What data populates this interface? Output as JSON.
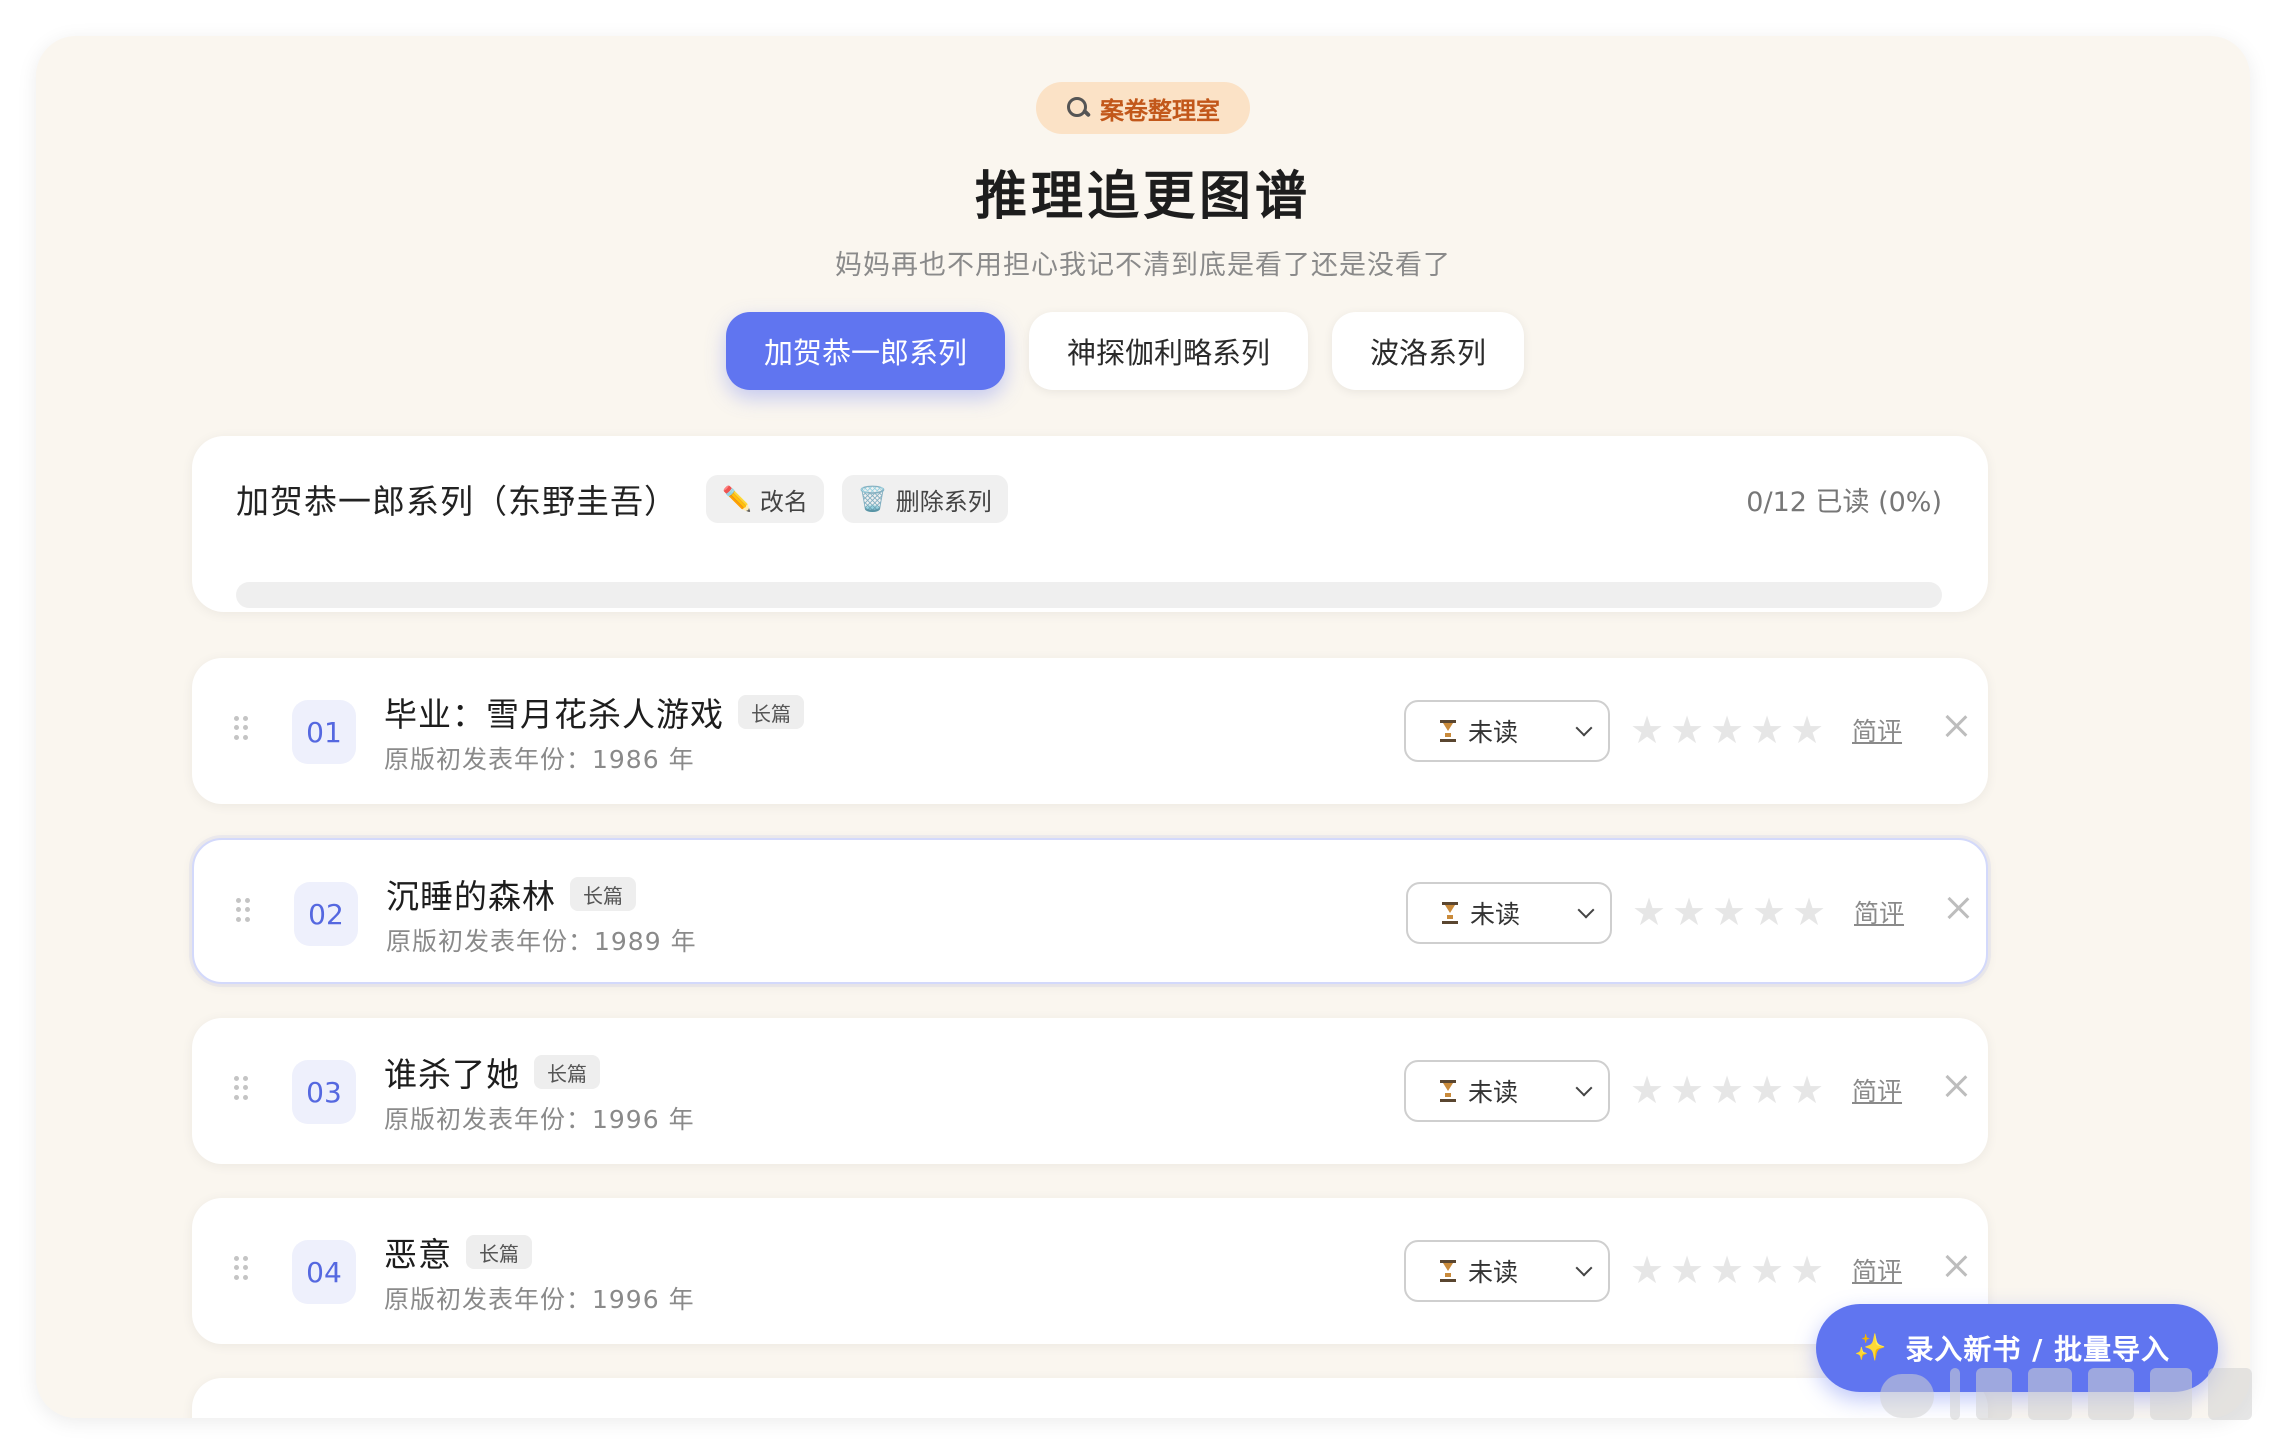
{
  "header": {
    "badge": "案卷整理室",
    "title": "推理追更图谱",
    "subtitle": "妈妈再也不用担心我记不清到底是看了还是没看了"
  },
  "tabs": [
    {
      "label": "加贺恭一郎系列",
      "active": true
    },
    {
      "label": "神探伽利略系列",
      "active": false
    },
    {
      "label": "波洛系列",
      "active": false
    }
  ],
  "series": {
    "name": "加贺恭一郎系列（东野圭吾）",
    "rename_label": "改名",
    "delete_label": "删除系列",
    "progress_text": "0/12 已读 (0%)",
    "progress_fraction": 0
  },
  "books": [
    {
      "num": "01",
      "title": "毕业：雪月花杀人游戏",
      "tag": "长篇",
      "year": "原版初发表年份：1986 年",
      "status": "未读",
      "rating": 0,
      "review": "简评"
    },
    {
      "num": "02",
      "title": "沉睡的森林",
      "tag": "长篇",
      "year": "原版初发表年份：1989 年",
      "status": "未读",
      "rating": 0,
      "review": "简评"
    },
    {
      "num": "03",
      "title": "谁杀了她",
      "tag": "长篇",
      "year": "原版初发表年份：1996 年",
      "status": "未读",
      "rating": 0,
      "review": "简评"
    },
    {
      "num": "04",
      "title": "恶意",
      "tag": "长篇",
      "year": "原版初发表年份：1996 年",
      "status": "未读",
      "rating": 0,
      "review": "简评"
    }
  ],
  "fab": {
    "label": "录入新书 / 批量导入"
  },
  "colors": {
    "accent": "#6075f0",
    "badge_bg": "#fbe2c6",
    "badge_text": "#c2571a",
    "page_bg": "#faf6ef"
  }
}
